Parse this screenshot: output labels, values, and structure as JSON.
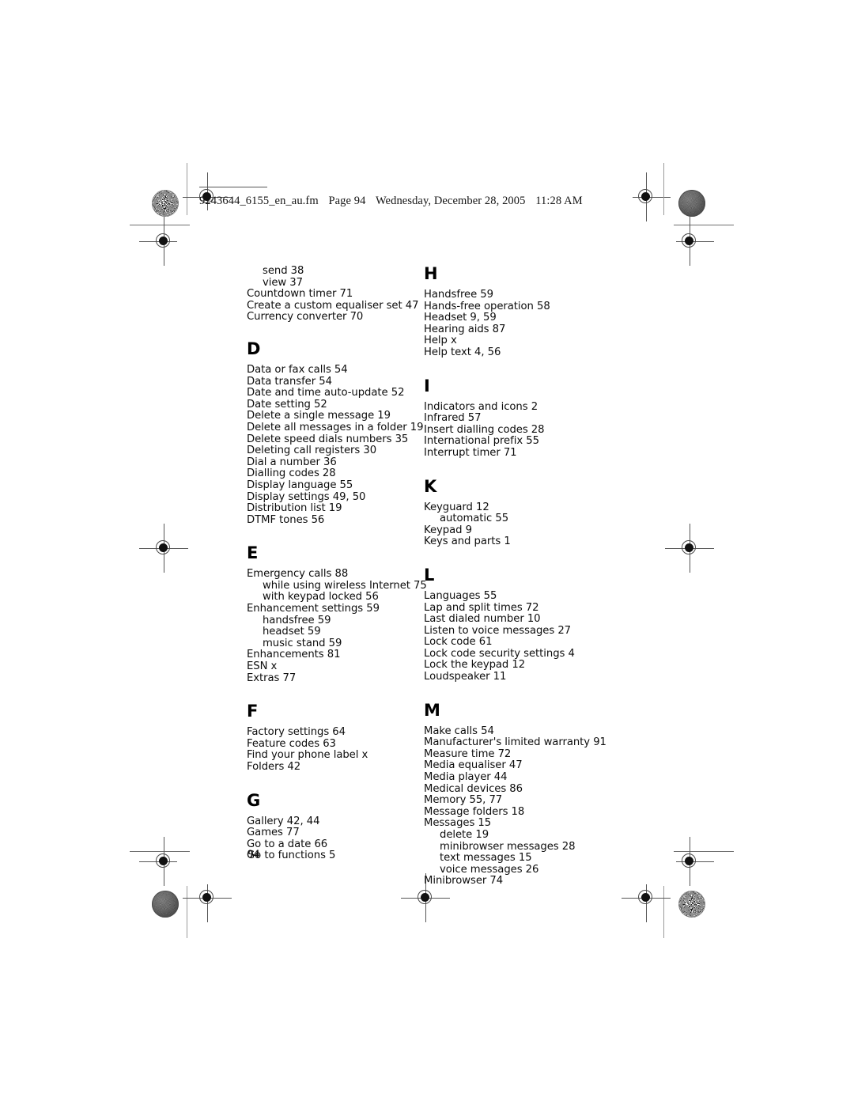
{
  "page": {
    "fm_header": {
      "filename": "9243644_6155_en_au.fm",
      "page_label": "Page 94",
      "weekday": "Wednesday, December 28, 2005",
      "time": "11:28 AM"
    },
    "folio": "94"
  },
  "index": {
    "columns": [
      {
        "name": "left-column",
        "sections": [
          {
            "heading": "",
            "entries": [
              {
                "text": "send 38",
                "level": 1
              },
              {
                "text": "view 37",
                "level": 1
              },
              {
                "text": "Countdown timer 71",
                "level": 0
              },
              {
                "text": "Create a custom equaliser set 47",
                "level": 0
              },
              {
                "text": "Currency converter 70",
                "level": 0
              }
            ]
          },
          {
            "heading": "D",
            "entries": [
              {
                "text": "Data or fax calls 54",
                "level": 0
              },
              {
                "text": "Data transfer 54",
                "level": 0
              },
              {
                "text": "Date and time auto-update 52",
                "level": 0
              },
              {
                "text": "Date setting 52",
                "level": 0
              },
              {
                "text": "Delete a single message 19",
                "level": 0
              },
              {
                "text": "Delete all messages in a folder 19",
                "level": 0
              },
              {
                "text": "Delete speed dials numbers 35",
                "level": 0
              },
              {
                "text": "Deleting call registers 30",
                "level": 0
              },
              {
                "text": "Dial a number 36",
                "level": 0
              },
              {
                "text": "Dialling codes 28",
                "level": 0
              },
              {
                "text": "Display language 55",
                "level": 0
              },
              {
                "text": "Display settings 49, 50",
                "level": 0
              },
              {
                "text": "Distribution list 19",
                "level": 0
              },
              {
                "text": "DTMF tones 56",
                "level": 0
              }
            ]
          },
          {
            "heading": "E",
            "entries": [
              {
                "text": "Emergency calls 88",
                "level": 0
              },
              {
                "text": "while using wireless Internet 75",
                "level": 1
              },
              {
                "text": "with keypad locked 56",
                "level": 1
              },
              {
                "text": "Enhancement settings 59",
                "level": 0
              },
              {
                "text": "handsfree 59",
                "level": 1
              },
              {
                "text": "headset 59",
                "level": 1
              },
              {
                "text": "music stand 59",
                "level": 1
              },
              {
                "text": "Enhancements 81",
                "level": 0
              },
              {
                "text": "ESN x",
                "level": 0
              },
              {
                "text": "Extras 77",
                "level": 0
              }
            ]
          },
          {
            "heading": "F",
            "entries": [
              {
                "text": "Factory settings 64",
                "level": 0
              },
              {
                "text": "Feature codes 63",
                "level": 0
              },
              {
                "text": "Find your phone label x",
                "level": 0
              },
              {
                "text": "Folders 42",
                "level": 0
              }
            ]
          },
          {
            "heading": "G",
            "entries": [
              {
                "text": "Gallery 42, 44",
                "level": 0
              },
              {
                "text": "Games 77",
                "level": 0
              },
              {
                "text": "Go to a date 66",
                "level": 0
              },
              {
                "text": "Go to functions 5",
                "level": 0
              }
            ]
          }
        ]
      },
      {
        "name": "right-column",
        "sections": [
          {
            "heading": "H",
            "entries": [
              {
                "text": "Handsfree 59",
                "level": 0
              },
              {
                "text": "Hands-free operation 58",
                "level": 0
              },
              {
                "text": "Headset 9, 59",
                "level": 0
              },
              {
                "text": "Hearing aids 87",
                "level": 0
              },
              {
                "text": "Help x",
                "level": 0
              },
              {
                "text": "Help text 4, 56",
                "level": 0
              }
            ]
          },
          {
            "heading": "I",
            "entries": [
              {
                "text": "Indicators and icons 2",
                "level": 0
              },
              {
                "text": "Infrared 57",
                "level": 0
              },
              {
                "text": "Insert dialling codes 28",
                "level": 0
              },
              {
                "text": "International prefix 55",
                "level": 0
              },
              {
                "text": "Interrupt timer 71",
                "level": 0
              }
            ]
          },
          {
            "heading": "K",
            "entries": [
              {
                "text": "Keyguard 12",
                "level": 0
              },
              {
                "text": "automatic 55",
                "level": 1
              },
              {
                "text": "Keypad 9",
                "level": 0
              },
              {
                "text": "Keys and parts 1",
                "level": 0
              }
            ]
          },
          {
            "heading": "L",
            "entries": [
              {
                "text": "Languages 55",
                "level": 0
              },
              {
                "text": "Lap and split times 72",
                "level": 0
              },
              {
                "text": "Last dialed number 10",
                "level": 0
              },
              {
                "text": "Listen to voice messages 27",
                "level": 0
              },
              {
                "text": "Lock code 61",
                "level": 0
              },
              {
                "text": "Lock code security settings 4",
                "level": 0
              },
              {
                "text": "Lock the keypad 12",
                "level": 0
              },
              {
                "text": "Loudspeaker 11",
                "level": 0
              }
            ]
          },
          {
            "heading": "M",
            "entries": [
              {
                "text": "Make calls 54",
                "level": 0
              },
              {
                "text": "Manufacturer's limited warranty 91",
                "level": 0
              },
              {
                "text": "Measure time 72",
                "level": 0
              },
              {
                "text": "Media equaliser 47",
                "level": 0
              },
              {
                "text": "Media player 44",
                "level": 0
              },
              {
                "text": "Medical devices 86",
                "level": 0
              },
              {
                "text": "Memory 55, 77",
                "level": 0
              },
              {
                "text": "Message folders 18",
                "level": 0
              },
              {
                "text": "Messages 15",
                "level": 0
              },
              {
                "text": "delete 19",
                "level": 1
              },
              {
                "text": "minibrowser messages 28",
                "level": 1
              },
              {
                "text": "text messages 15",
                "level": 1
              },
              {
                "text": "voice messages 26",
                "level": 1
              },
              {
                "text": "Minibrowser 74",
                "level": 0
              }
            ]
          }
        ]
      }
    ]
  }
}
